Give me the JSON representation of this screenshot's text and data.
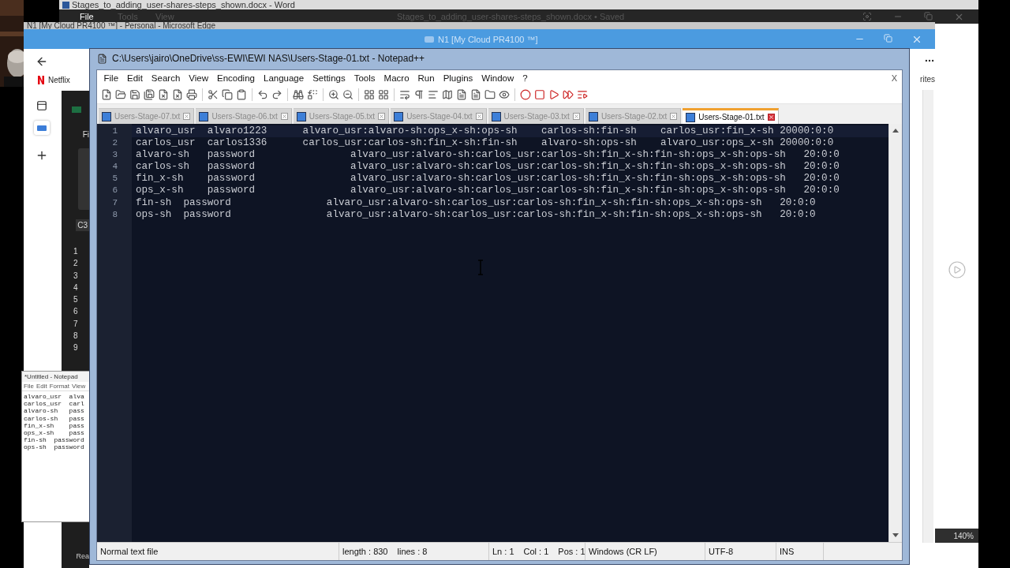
{
  "word": {
    "title": "Stages_to_adding_user-shares-steps_shown.docx - Word",
    "menu": [
      "File",
      "Tools",
      "View"
    ],
    "document_title": "Stages_to_adding_user-shares-steps_shown.docx • Saved"
  },
  "edge": {
    "title": "N1 [My Cloud PR4100 ™] - Personal - Microsoft Edge",
    "tab_title": "N1 [My Cloud PR4100 ™]",
    "favorites": [
      "Netflix"
    ],
    "favorites_label": "rites",
    "zoom": "140%"
  },
  "excel": {
    "ribbon_tab": "Fi",
    "name_box": "C3",
    "rows": [
      "1",
      "2",
      "3",
      "4",
      "5",
      "6",
      "7",
      "8",
      "9"
    ],
    "status": "Rea"
  },
  "notepad": {
    "title": "*Untitled - Notepad",
    "menu": [
      "File",
      "Edit",
      "Format",
      "View"
    ],
    "lines": [
      "alvaro_usr  alva",
      "carlos_usr  carl",
      "alvaro-sh   pass",
      "carlos-sh   pass",
      "fin_x-sh    pass",
      "ops_x-sh    pass",
      "fin-sh  password",
      "ops-sh  password"
    ]
  },
  "notepadpp": {
    "title": "C:\\Users\\jairo\\OneDrive\\ss-EWI\\EWI NAS\\Users-Stage-01.txt - Notepad++",
    "menu": [
      "File",
      "Edit",
      "Search",
      "View",
      "Encoding",
      "Language",
      "Settings",
      "Tools",
      "Macro",
      "Run",
      "Plugins",
      "Window",
      "?"
    ],
    "close_label": "X",
    "tabs": [
      {
        "label": "Users-Stage-07.txt",
        "selected": false
      },
      {
        "label": "Users-Stage-06.txt",
        "selected": false
      },
      {
        "label": "Users-Stage-05.txt",
        "selected": false
      },
      {
        "label": "Users-Stage-04.txt",
        "selected": false
      },
      {
        "label": "Users-Stage-03.txt",
        "selected": false
      },
      {
        "label": "Users-Stage-02.txt",
        "selected": false
      },
      {
        "label": "Users-Stage-01.txt",
        "selected": true
      }
    ],
    "lines": [
      {
        "number": "1",
        "text": "alvaro_usr  alvaro1223      alvaro_usr:alvaro-sh:ops_x-sh:ops-sh    carlos-sh:fin-sh    carlos_usr:fin_x-sh 20000:0:0",
        "current": true
      },
      {
        "number": "2",
        "text": "carlos_usr  carlos1336      carlos_usr:carlos-sh:fin_x-sh:fin-sh    alvaro-sh:ops-sh    alvaro_usr:ops_x-sh 20000:0:0",
        "current": false
      },
      {
        "number": "3",
        "text": "alvaro-sh   password                alvaro_usr:alvaro-sh:carlos_usr:carlos-sh:fin_x-sh:fin-sh:ops_x-sh:ops-sh   20:0:0",
        "current": false
      },
      {
        "number": "4",
        "text": "carlos-sh   password                alvaro_usr:alvaro-sh:carlos_usr:carlos-sh:fin_x-sh:fin-sh:ops_x-sh:ops-sh   20:0:0",
        "current": false
      },
      {
        "number": "5",
        "text": "fin_x-sh    password                alvaro_usr:alvaro-sh:carlos_usr:carlos-sh:fin_x-sh:fin-sh:ops_x-sh:ops-sh   20:0:0",
        "current": false
      },
      {
        "number": "6",
        "text": "ops_x-sh    password                alvaro_usr:alvaro-sh:carlos_usr:carlos-sh:fin_x-sh:fin-sh:ops_x-sh:ops-sh   20:0:0",
        "current": false
      },
      {
        "number": "7",
        "text": "fin-sh  password                alvaro_usr:alvaro-sh:carlos_usr:carlos-sh:fin_x-sh:fin-sh:ops_x-sh:ops-sh   20:0:0",
        "current": false
      },
      {
        "number": "8",
        "text": "ops-sh  password                alvaro_usr:alvaro-sh:carlos_usr:carlos-sh:fin_x-sh:fin-sh:ops_x-sh:ops-sh   20:0:0",
        "current": false
      }
    ],
    "status_bar": [
      {
        "items": [
          "Normal text file"
        ]
      },
      {
        "items": [
          "length : 830",
          "lines : 8"
        ]
      },
      {
        "items": [
          "Ln : 1",
          "Col : 1",
          "Pos : 1"
        ]
      },
      {
        "items": [
          "Windows (CR LF)"
        ]
      },
      {
        "items": [
          "UTF-8"
        ]
      },
      {
        "items": [
          "INS"
        ]
      }
    ]
  }
}
